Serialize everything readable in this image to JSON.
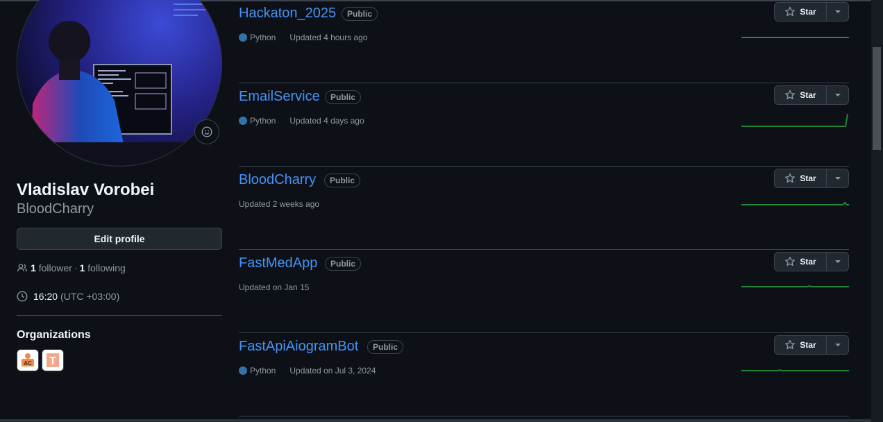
{
  "profile": {
    "full_name": "Vladislav Vorobei",
    "login": "BloodCharry",
    "edit_label": "Edit profile",
    "followers_count": "1",
    "followers_label": "follower",
    "separator": "·",
    "following_count": "1",
    "following_label": "following",
    "local_time": "16:20",
    "timezone": "(UTC +03:00)",
    "organizations_title": "Organizations",
    "organizations": [
      {
        "name": "org-ac",
        "text": "AC"
      },
      {
        "name": "org-t",
        "text": "T"
      }
    ]
  },
  "repos": [
    {
      "name": "Hackaton_2025",
      "visibility": "Public",
      "language": "Python",
      "updated": "Updated 4 hours ago",
      "star_label": "Star"
    },
    {
      "name": "EmailService",
      "visibility": "Public",
      "language": "Python",
      "updated": "Updated 4 days ago",
      "star_label": "Star"
    },
    {
      "name": "BloodCharry",
      "visibility": "Public",
      "language": "",
      "updated": "Updated 2 weeks ago",
      "star_label": "Star"
    },
    {
      "name": "FastMedApp",
      "visibility": "Public",
      "language": "",
      "updated": "Updated on Jan 15",
      "star_label": "Star"
    },
    {
      "name": "FastApiAiogramBot",
      "visibility": "Public",
      "language": "Python",
      "updated": "Updated on Jul 3, 2024",
      "star_label": "Star"
    }
  ],
  "colors": {
    "link": "#4493f8",
    "python": "#3572a5",
    "spark": "#238636"
  }
}
